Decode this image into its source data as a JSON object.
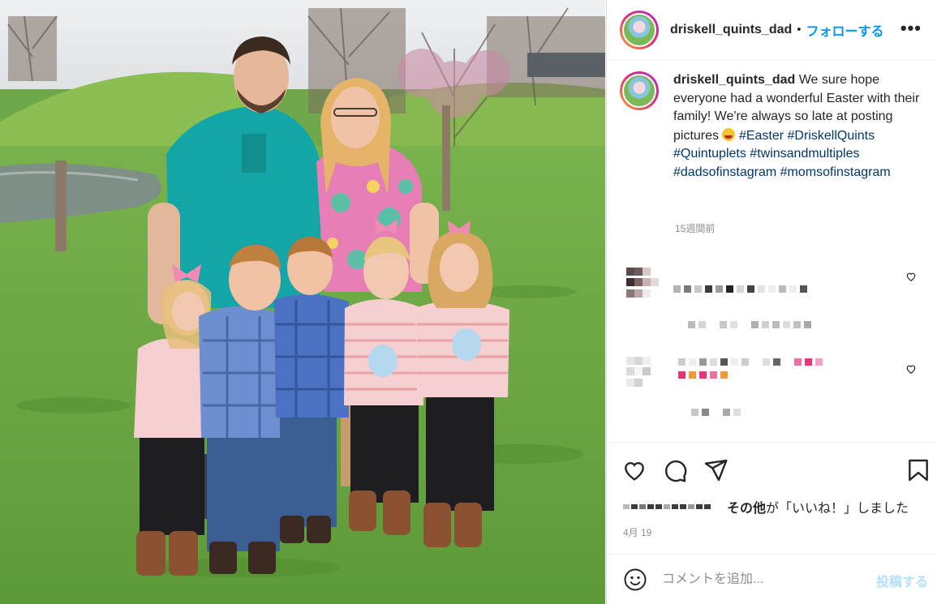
{
  "header": {
    "username": "driskell_quints_dad",
    "separator": "•",
    "follow_label": "フォローする",
    "more_label": "•••"
  },
  "caption": {
    "username": "driskell_quints_dad",
    "text": "We sure hope everyone had a wonderful Easter with their family! We're always so late at posting pictures",
    "emoji": "laughing-face-emoji",
    "hashtags": [
      "#Easter",
      "#DriskellQuints",
      "#Quintuplets",
      "#twinsandmultiples",
      "#dadsofinstagram",
      "#momsofinstagram"
    ],
    "time_ago": "15週間前"
  },
  "actions": {
    "likes_suffix_bold": "その他",
    "likes_suffix_rest": "が「いいね！」しました",
    "date": "4月 19"
  },
  "add_comment": {
    "placeholder": "コメントを追加...",
    "post_label": "投稿する"
  },
  "colors": {
    "accent": "#0095f6",
    "hashtag": "#00376b",
    "post_disabled": "#b2dffc",
    "muted": "#8e8e8e"
  },
  "icons": [
    "more-icon",
    "heart-icon",
    "comment-icon",
    "share-icon",
    "bookmark-icon",
    "smile-icon"
  ]
}
